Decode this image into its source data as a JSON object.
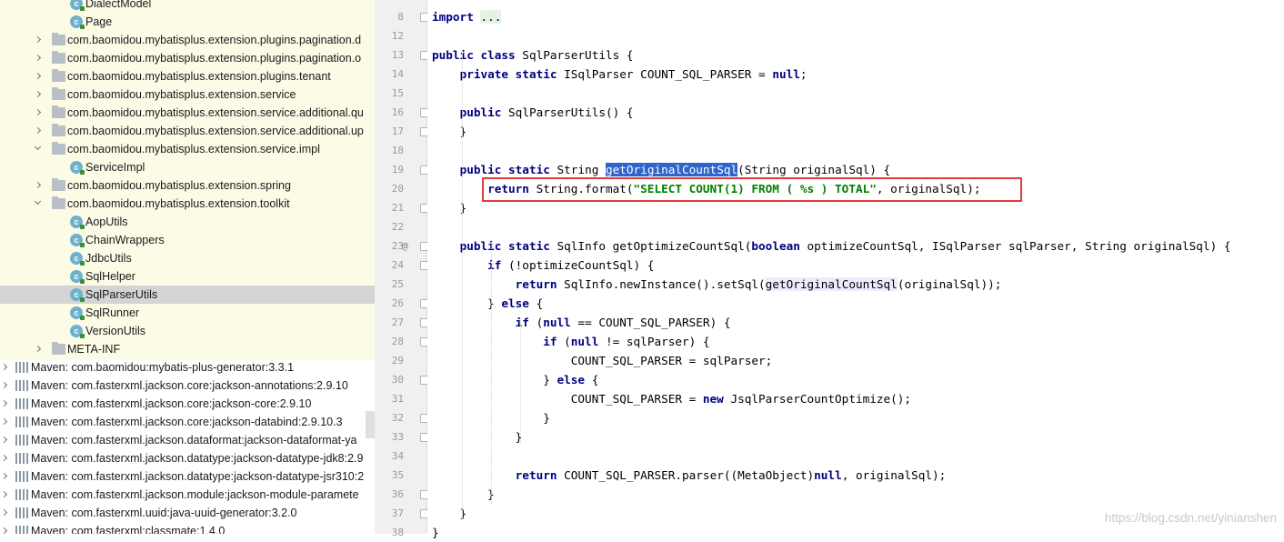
{
  "project_tree": {
    "rows": [
      {
        "label": "DialectModel",
        "icon": "class-icon",
        "type": "class"
      },
      {
        "label": "Page",
        "icon": "class-icon",
        "type": "class"
      },
      {
        "label": "com.baomidou.mybatisplus.extension.plugins.pagination.d",
        "icon": "package-icon",
        "type": "package",
        "expanded": false
      },
      {
        "label": "com.baomidou.mybatisplus.extension.plugins.pagination.o",
        "icon": "package-icon",
        "type": "package",
        "expanded": false
      },
      {
        "label": "com.baomidou.mybatisplus.extension.plugins.tenant",
        "icon": "package-icon",
        "type": "package",
        "expanded": false
      },
      {
        "label": "com.baomidou.mybatisplus.extension.service",
        "icon": "package-icon",
        "type": "package",
        "expanded": false
      },
      {
        "label": "com.baomidou.mybatisplus.extension.service.additional.qu",
        "icon": "package-icon",
        "type": "package",
        "expanded": false
      },
      {
        "label": "com.baomidou.mybatisplus.extension.service.additional.up",
        "icon": "package-icon",
        "type": "package",
        "expanded": false
      },
      {
        "label": "com.baomidou.mybatisplus.extension.service.impl",
        "icon": "package-icon",
        "type": "package",
        "expanded": true
      },
      {
        "label": "ServiceImpl",
        "icon": "class-icon",
        "type": "class"
      },
      {
        "label": "com.baomidou.mybatisplus.extension.spring",
        "icon": "package-icon",
        "type": "package",
        "expanded": false
      },
      {
        "label": "com.baomidou.mybatisplus.extension.toolkit",
        "icon": "package-icon",
        "type": "package",
        "expanded": true
      },
      {
        "label": "AopUtils",
        "icon": "class-icon",
        "type": "class"
      },
      {
        "label": "ChainWrappers",
        "icon": "class-icon",
        "type": "class"
      },
      {
        "label": "JdbcUtils",
        "icon": "class-icon",
        "type": "class"
      },
      {
        "label": "SqlHelper",
        "icon": "class-icon",
        "type": "class"
      },
      {
        "label": "SqlParserUtils",
        "icon": "class-icon",
        "type": "class",
        "selected": true
      },
      {
        "label": "SqlRunner",
        "icon": "class-icon",
        "type": "class"
      },
      {
        "label": "VersionUtils",
        "icon": "class-icon",
        "type": "class"
      },
      {
        "label": "META-INF",
        "icon": "package-icon",
        "type": "folder",
        "expanded": false
      },
      {
        "label": "Maven: com.baomidou:mybatis-plus-generator:3.3.1",
        "icon": "library-icon",
        "type": "library"
      },
      {
        "label": "Maven: com.fasterxml.jackson.core:jackson-annotations:2.9.10",
        "icon": "library-icon",
        "type": "library"
      },
      {
        "label": "Maven: com.fasterxml.jackson.core:jackson-core:2.9.10",
        "icon": "library-icon",
        "type": "library"
      },
      {
        "label": "Maven: com.fasterxml.jackson.core:jackson-databind:2.9.10.3",
        "icon": "library-icon",
        "type": "library"
      },
      {
        "label": "Maven: com.fasterxml.jackson.dataformat:jackson-dataformat-ya",
        "icon": "library-icon",
        "type": "library"
      },
      {
        "label": "Maven: com.fasterxml.jackson.datatype:jackson-datatype-jdk8:2.9",
        "icon": "library-icon",
        "type": "library"
      },
      {
        "label": "Maven: com.fasterxml.jackson.datatype:jackson-datatype-jsr310:2",
        "icon": "library-icon",
        "type": "library"
      },
      {
        "label": "Maven: com.fasterxml.jackson.module:jackson-module-paramete",
        "icon": "library-icon",
        "type": "library"
      },
      {
        "label": "Maven: com.fasterxml.uuid:java-uuid-generator:3.2.0",
        "icon": "library-icon",
        "type": "library"
      },
      {
        "label": "Maven: com.fasterxml:classmate:1.4.0",
        "icon": "library-icon",
        "type": "library"
      }
    ]
  },
  "editor": {
    "lines": [
      {
        "num": "8",
        "fold": true,
        "tokens": [
          [
            "kw",
            "import"
          ],
          [
            "t",
            " "
          ],
          [
            "fold",
            "..."
          ]
        ]
      },
      {
        "num": "12",
        "tokens": []
      },
      {
        "num": "13",
        "fold": true,
        "tokens": [
          [
            "kw",
            "public class"
          ],
          [
            "t",
            " SqlParserUtils {"
          ]
        ]
      },
      {
        "num": "14",
        "tokens": [
          [
            "t",
            "    "
          ],
          [
            "kw",
            "private static"
          ],
          [
            "t",
            " ISqlParser COUNT_SQL_PARSER = "
          ],
          [
            "kw",
            "null"
          ],
          [
            "t",
            ";"
          ]
        ]
      },
      {
        "num": "15",
        "tokens": []
      },
      {
        "num": "16",
        "fold": true,
        "tokens": [
          [
            "t",
            "    "
          ],
          [
            "kw",
            "public"
          ],
          [
            "t",
            " SqlParserUtils() {"
          ]
        ]
      },
      {
        "num": "17",
        "fold": true,
        "tokens": [
          [
            "t",
            "    }"
          ]
        ]
      },
      {
        "num": "18",
        "tokens": []
      },
      {
        "num": "19",
        "fold": true,
        "tokens": [
          [
            "t",
            "    "
          ],
          [
            "kw",
            "public static"
          ],
          [
            "t",
            " String "
          ],
          [
            "sel",
            "getOriginalCountSql"
          ],
          [
            "t",
            "(String originalSql) {"
          ]
        ]
      },
      {
        "num": "20",
        "tokens": [
          [
            "t",
            "        "
          ],
          [
            "kw",
            "return"
          ],
          [
            "t",
            " String.format("
          ],
          [
            "str",
            "\"SELECT COUNT(1) FROM ( %s ) TOTAL\""
          ],
          [
            "t",
            ", originalSql);"
          ]
        ]
      },
      {
        "num": "21",
        "fold": true,
        "tokens": [
          [
            "t",
            "    }"
          ]
        ]
      },
      {
        "num": "22",
        "tokens": []
      },
      {
        "num": "23",
        "annotation": "@",
        "fold": true,
        "tokens": [
          [
            "t",
            "    "
          ],
          [
            "kw",
            "public static"
          ],
          [
            "t",
            " SqlInfo getOptimizeCountSql("
          ],
          [
            "kw",
            "boolean"
          ],
          [
            "t",
            " optimizeCountSql, ISqlParser sqlParser, String originalSql) {"
          ]
        ]
      },
      {
        "num": "24",
        "fold": true,
        "tokens": [
          [
            "t",
            "        "
          ],
          [
            "kw",
            "if"
          ],
          [
            "t",
            " (!optimizeCountSql) {"
          ]
        ]
      },
      {
        "num": "25",
        "tokens": [
          [
            "t",
            "            "
          ],
          [
            "kw",
            "return"
          ],
          [
            "t",
            " SqlInfo.newInstance().setSql("
          ],
          [
            "ref",
            "getOriginalCountSql"
          ],
          [
            "t",
            "(originalSql));"
          ]
        ]
      },
      {
        "num": "26",
        "fold": true,
        "tokens": [
          [
            "t",
            "        } "
          ],
          [
            "kw",
            "else"
          ],
          [
            "t",
            " {"
          ]
        ]
      },
      {
        "num": "27",
        "fold": true,
        "tokens": [
          [
            "t",
            "            "
          ],
          [
            "kw",
            "if"
          ],
          [
            "t",
            " ("
          ],
          [
            "kw",
            "null"
          ],
          [
            "t",
            " == COUNT_SQL_PARSER) {"
          ]
        ]
      },
      {
        "num": "28",
        "fold": true,
        "tokens": [
          [
            "t",
            "                "
          ],
          [
            "kw",
            "if"
          ],
          [
            "t",
            " ("
          ],
          [
            "kw",
            "null"
          ],
          [
            "t",
            " != sqlParser) {"
          ]
        ]
      },
      {
        "num": "29",
        "tokens": [
          [
            "t",
            "                    COUNT_SQL_PARSER = sqlParser;"
          ]
        ]
      },
      {
        "num": "30",
        "fold": true,
        "tokens": [
          [
            "t",
            "                } "
          ],
          [
            "kw",
            "else"
          ],
          [
            "t",
            " {"
          ]
        ]
      },
      {
        "num": "31",
        "tokens": [
          [
            "t",
            "                    COUNT_SQL_PARSER = "
          ],
          [
            "kw",
            "new"
          ],
          [
            "t",
            " JsqlParserCountOptimize();"
          ]
        ]
      },
      {
        "num": "32",
        "fold": true,
        "tokens": [
          [
            "t",
            "                }"
          ]
        ]
      },
      {
        "num": "33",
        "fold": true,
        "tokens": [
          [
            "t",
            "            }"
          ]
        ]
      },
      {
        "num": "34",
        "tokens": []
      },
      {
        "num": "35",
        "tokens": [
          [
            "t",
            "            "
          ],
          [
            "kw",
            "return"
          ],
          [
            "t",
            " COUNT_SQL_PARSER.parser((MetaObject)"
          ],
          [
            "kw",
            "null"
          ],
          [
            "t",
            ", originalSql);"
          ]
        ]
      },
      {
        "num": "36",
        "fold": true,
        "tokens": [
          [
            "t",
            "        }"
          ]
        ]
      },
      {
        "num": "37",
        "fold": true,
        "tokens": [
          [
            "t",
            "    }"
          ]
        ]
      },
      {
        "num": "38",
        "tokens": [
          [
            "t",
            "}"
          ]
        ]
      }
    ]
  },
  "highlight_box_color": "#e03c3c",
  "watermark": "https://blog.csdn.net/yinianshen"
}
